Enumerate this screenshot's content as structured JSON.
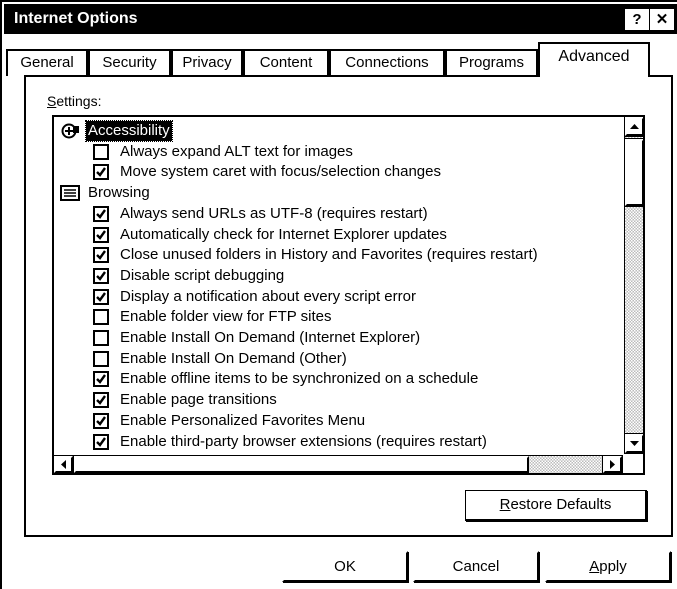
{
  "window": {
    "title": "Internet Options",
    "help_btn": "?",
    "close_btn": "✕"
  },
  "tabs": [
    {
      "label": "General"
    },
    {
      "label": "Security"
    },
    {
      "label": "Privacy"
    },
    {
      "label": "Content"
    },
    {
      "label": "Connections"
    },
    {
      "label": "Programs"
    },
    {
      "label": "Advanced",
      "active": true
    }
  ],
  "settings": {
    "label_mnemonic": "S",
    "label_rest": "ettings:",
    "rows": [
      {
        "type": "category",
        "icon": "accessibility-icon",
        "text": "Accessibility",
        "selected": true
      },
      {
        "type": "option",
        "checked": false,
        "text": "Always expand ALT text for images"
      },
      {
        "type": "option",
        "checked": true,
        "text": "Move system caret with focus/selection changes"
      },
      {
        "type": "category",
        "icon": "browsing-icon",
        "text": "Browsing",
        "selected": false
      },
      {
        "type": "option",
        "checked": true,
        "text": "Always send URLs as UTF-8 (requires restart)"
      },
      {
        "type": "option",
        "checked": true,
        "text": "Automatically check for Internet Explorer updates"
      },
      {
        "type": "option",
        "checked": true,
        "text": "Close unused folders in History and Favorites (requires restart)"
      },
      {
        "type": "option",
        "checked": true,
        "text": "Disable script debugging"
      },
      {
        "type": "option",
        "checked": true,
        "text": "Display a notification about every script error"
      },
      {
        "type": "option",
        "checked": false,
        "text": "Enable folder view for FTP sites"
      },
      {
        "type": "option",
        "checked": false,
        "text": "Enable Install On Demand (Internet Explorer)"
      },
      {
        "type": "option",
        "checked": false,
        "text": "Enable Install On Demand (Other)"
      },
      {
        "type": "option",
        "checked": true,
        "text": "Enable offline items to be synchronized on a schedule"
      },
      {
        "type": "option",
        "checked": true,
        "text": "Enable page transitions"
      },
      {
        "type": "option",
        "checked": true,
        "text": "Enable Personalized Favorites Menu"
      },
      {
        "type": "option",
        "checked": true,
        "text": "Enable third-party browser extensions (requires restart)"
      }
    ]
  },
  "buttons": {
    "restore_mnemonic": "R",
    "restore_rest": "estore Defaults",
    "ok": "OK",
    "cancel": "Cancel",
    "apply_mnemonic": "A",
    "apply_rest": "pply"
  },
  "colors": {
    "background": "#ffffff",
    "foreground": "#000000"
  }
}
